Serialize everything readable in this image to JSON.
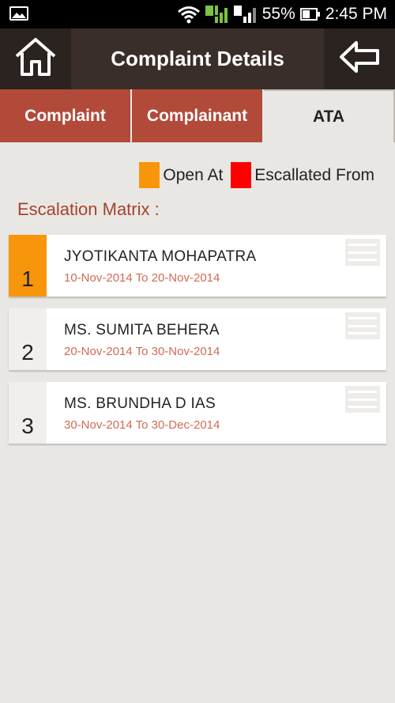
{
  "status_bar": {
    "battery_percent": "55%",
    "time": "2:45 PM",
    "sim1_label": "1",
    "sim2_label": "2",
    "icons": [
      "gallery-icon",
      "wifi-icon",
      "sim1-signal-icon",
      "sim2-signal-icon",
      "battery-icon"
    ]
  },
  "header": {
    "title": "Complaint Details",
    "home_icon": "home-icon",
    "back_icon": "back-arrow-icon"
  },
  "tabs": [
    {
      "label": "Complaint",
      "active": false
    },
    {
      "label": "Complainant",
      "active": false
    },
    {
      "label": "ATA",
      "active": true
    }
  ],
  "legend": {
    "open_label": "Open At",
    "open_color": "#f7960b",
    "escalated_label": "Escallated From",
    "escalated_color": "#ff0000"
  },
  "section_title": "Escalation Matrix :",
  "escalations": [
    {
      "index": "1",
      "name": "JYOTIKANTA MOHAPATRA",
      "dates": "10-Nov-2014 To 20-Nov-2014",
      "status": "open"
    },
    {
      "index": "2",
      "name": "MS. SUMITA BEHERA",
      "dates": "20-Nov-2014 To 30-Nov-2014",
      "status": "none"
    },
    {
      "index": "3",
      "name": "MS. BRUNDHA D IAS",
      "dates": "30-Nov-2014 To 30-Dec-2014",
      "status": "none"
    }
  ],
  "colors": {
    "accent_red": "#b24a3a",
    "header_bg": "#3a2e2a",
    "date_text": "#cf6b52"
  }
}
